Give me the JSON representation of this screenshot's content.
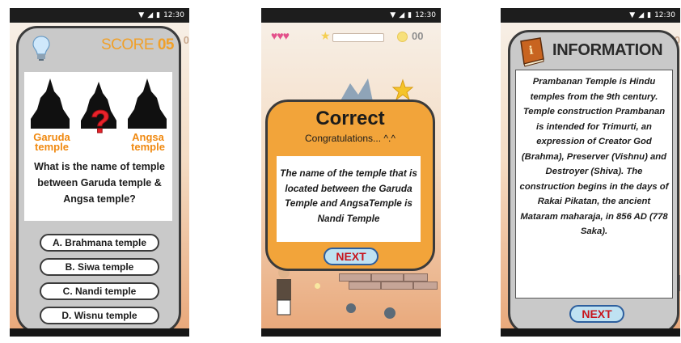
{
  "status": {
    "time": "12:30"
  },
  "screen1": {
    "score_label": "SCORE",
    "score_value": "05",
    "bg_score_partial": "0",
    "temple_left_label": "Garuda temple",
    "temple_right_label": "Angsa temple",
    "question_mark": "?",
    "question": "What is the name of temple between Garuda temple & Angsa temple?",
    "options": [
      {
        "label": "A. Brahmana temple"
      },
      {
        "label": "B. Siwa temple"
      },
      {
        "label": "C. Nandi temple"
      },
      {
        "label": "D. Wisnu temple"
      }
    ]
  },
  "screen2": {
    "lives": "♥♥♥",
    "star": "★",
    "coins": "00",
    "title": "Correct",
    "subtitle": "Congratulations... ^.^",
    "message": "The name of the temple that is located between the Garuda Temple and AngsaTemple is Nandi Temple",
    "next_label": "NEXT"
  },
  "screen3": {
    "title": "INFORMATION",
    "bg_partial": "0",
    "text": "Prambanan Temple is Hindu temples from the 9th century. Temple construction Prambanan is intended for Trimurti, an expression of Creator God (Brahma), Preserver (Vishnu) and Destroyer (Shiva). The construction begins in the days of Rakai Pikatan, the ancient Mataram maharaja, in 856 AD (778 Saka).",
    "next_label": "NEXT"
  },
  "colors": {
    "accent_orange": "#f0a02a",
    "next_text": "#c8141c",
    "next_bg": "#bfe2f2",
    "question_red": "#e8222a"
  }
}
